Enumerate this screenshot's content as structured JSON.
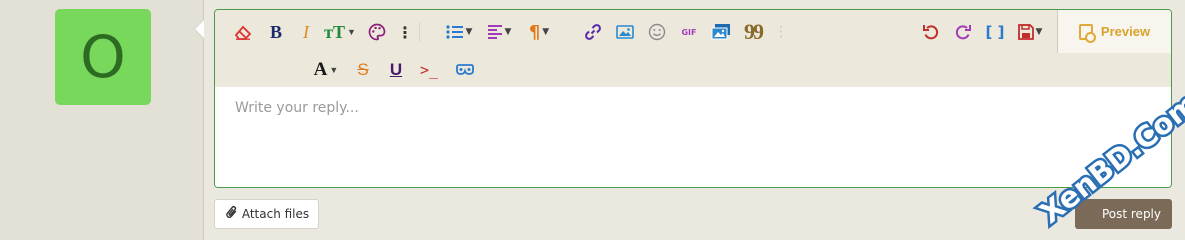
{
  "user": {
    "avatar_letter": "O",
    "avatar_color": "#77d85c"
  },
  "toolbar": {
    "icons": [
      "eraser-icon",
      "bold-icon",
      "italic-icon",
      "font-size-icon",
      "palette-icon",
      "more-vertical-icon",
      "list-icon",
      "align-icon",
      "paragraph-icon",
      "link-icon",
      "image-icon",
      "smilie-icon",
      "gif-icon",
      "media-icon",
      "quote-icon",
      "undo-icon",
      "redo-icon",
      "bbcode-icon",
      "drafts-icon",
      "text-color-icon",
      "strikethrough-icon",
      "underline-icon",
      "code-icon",
      "spoiler-icon"
    ],
    "bold": "B",
    "italic": "I",
    "font_size": "тT",
    "gif": "GIF",
    "quote": "99",
    "paragraph": "¶",
    "bbcode": "[ ]",
    "text_color": "A",
    "strike": "S",
    "underline": "U",
    "code": ">_"
  },
  "preview": {
    "label": "Preview"
  },
  "editor": {
    "placeholder": "Write your reply..."
  },
  "actions": {
    "attach_label": "Attach files",
    "post_label": "Post reply"
  },
  "watermark": {
    "text": "XenBD.Com"
  },
  "colors": {
    "border": "#4a9a4a",
    "accent": "#d9a22c",
    "post_bg": "#7a6a57",
    "watermark": "#2a6fb3"
  }
}
